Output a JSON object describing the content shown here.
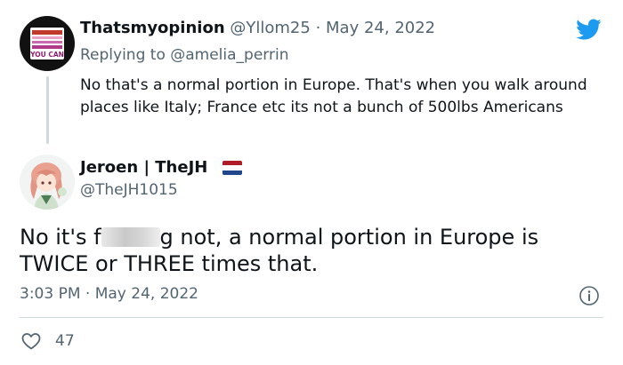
{
  "reply_tweet": {
    "display_name": "Thatsmyopinion",
    "handle": "@Yllom25",
    "separator": "·",
    "date": "May 24, 2022",
    "replying_prefix": "Replying to ",
    "replying_to": "@amelia_perrin",
    "text": "No that's a normal portion in Europe.  That's when you walk around places like Italy; France etc its not a bunch of 500lbs Americans",
    "avatar_text": "YOU CAN"
  },
  "main_tweet": {
    "display_name": "Jeroen | TheJH",
    "handle": "@TheJH1015",
    "text_before": "No it's f",
    "text_after": "g not, a normal portion in Europe is TWICE or THREE times that.",
    "time": "3:03 PM",
    "separator": "·",
    "date": "May 24, 2022",
    "like_count": "47"
  },
  "colors": {
    "twitter_blue": "#1d9bf0",
    "secondary_text": "#536471",
    "flag_red": "#ae1c28",
    "flag_white": "#ffffff",
    "flag_blue": "#21468b"
  },
  "icons": {
    "brand": "twitter-bird-icon",
    "info": "info-icon",
    "like": "heart-icon",
    "flag": "netherlands-flag-icon"
  }
}
